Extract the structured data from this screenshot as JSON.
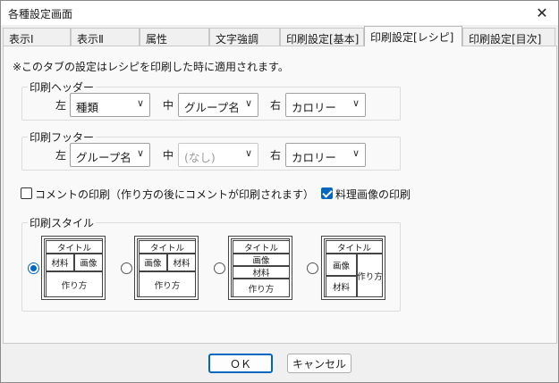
{
  "window": {
    "title": "各種設定画面",
    "close_glyph": "✕"
  },
  "tabs": [
    {
      "label": "表示Ⅰ"
    },
    {
      "label": "表示Ⅱ"
    },
    {
      "label": "属性"
    },
    {
      "label": "文字強調"
    },
    {
      "label": "印刷設定[基本]"
    },
    {
      "label": "印刷設定[レシピ]",
      "active": true
    },
    {
      "label": "印刷設定[目次]"
    }
  ],
  "note": "※このタブの設定はレシピを印刷した時に適用されます。",
  "header_group": {
    "label": "印刷ヘッダー",
    "left_label": "左",
    "center_label": "中",
    "right_label": "右",
    "left_value": "種類",
    "center_value": "グループ名",
    "right_value": "カロリー"
  },
  "footer_group": {
    "label": "印刷フッター",
    "left_label": "左",
    "center_label": "中",
    "right_label": "右",
    "left_value": "グループ名",
    "center_value": "(なし)",
    "right_value": "カロリー"
  },
  "options": {
    "comment_print": {
      "label": "コメントの印刷（作り方の後にコメントが印刷されます）",
      "checked": false
    },
    "image_print": {
      "label": "料理画像の印刷",
      "checked": true
    }
  },
  "style_group": {
    "label": "印刷スタイル",
    "selected": 0,
    "cells": {
      "title": "タイトル",
      "material": "材料",
      "image": "画像",
      "method": "作り方"
    }
  },
  "buttons": {
    "ok": "ＯＫ",
    "cancel": "キャンセル"
  },
  "icons": {
    "close": "close-icon",
    "dropdown": "chevron-down-icon"
  }
}
